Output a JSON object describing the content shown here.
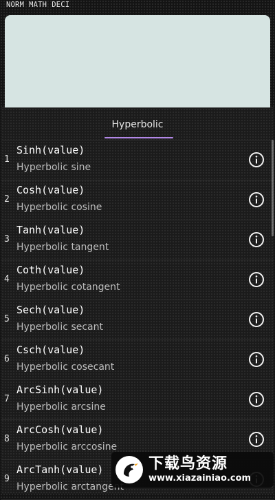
{
  "status_bar": {
    "modes": [
      "NORM",
      "MATH",
      "DECI"
    ]
  },
  "tabs": [
    {
      "label": "Hyperbolic",
      "selected": true
    }
  ],
  "colors": {
    "display_background": "#d6e4e2",
    "tab_indicator": "#b388e8",
    "background": "#141414"
  },
  "functions": [
    {
      "index": "1",
      "syntax": "Sinh(value)",
      "description": "Hyperbolic sine",
      "icon": "info-icon"
    },
    {
      "index": "2",
      "syntax": "Cosh(value)",
      "description": "Hyperbolic cosine",
      "icon": "info-icon"
    },
    {
      "index": "3",
      "syntax": "Tanh(value)",
      "description": "Hyperbolic tangent",
      "icon": "info-icon"
    },
    {
      "index": "4",
      "syntax": "Coth(value)",
      "description": "Hyperbolic cotangent",
      "icon": "info-icon"
    },
    {
      "index": "5",
      "syntax": "Sech(value)",
      "description": "Hyperbolic secant",
      "icon": "info-icon"
    },
    {
      "index": "6",
      "syntax": "Csch(value)",
      "description": "Hyperbolic cosecant",
      "icon": "info-icon"
    },
    {
      "index": "7",
      "syntax": "ArcSinh(value)",
      "description": "Hyperbolic arcsine",
      "icon": "info-icon"
    },
    {
      "index": "8",
      "syntax": "ArcCosh(value)",
      "description": "Hyperbolic arccosine",
      "icon": "info-icon"
    },
    {
      "index": "9",
      "syntax": "ArcTanh(value)",
      "description": "Hyperbolic arctangent",
      "icon": "info-icon"
    }
  ],
  "watermark": {
    "title": "下载鸟资源",
    "url": "www.xiazainiao.com"
  }
}
